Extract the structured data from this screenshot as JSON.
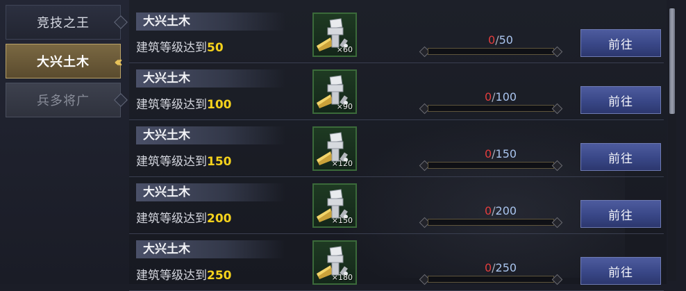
{
  "sidebar": {
    "tabs": [
      {
        "label": "竞技之王",
        "state": "normal"
      },
      {
        "label": "大兴土木",
        "state": "active"
      },
      {
        "label": "兵多将广",
        "state": "disabled"
      }
    ]
  },
  "tasks": [
    {
      "title": "大兴土木",
      "desc_prefix": "建筑等级达到",
      "target": "50",
      "reward_icon": "hammer-icon",
      "reward_count": "×60",
      "current": "0",
      "slash": "/",
      "total": "50",
      "button": "前往"
    },
    {
      "title": "大兴土木",
      "desc_prefix": "建筑等级达到",
      "target": "100",
      "reward_icon": "hammer-icon",
      "reward_count": "×90",
      "current": "0",
      "slash": "/",
      "total": "100",
      "button": "前往"
    },
    {
      "title": "大兴土木",
      "desc_prefix": "建筑等级达到",
      "target": "150",
      "reward_icon": "hammer-icon",
      "reward_count": "×120",
      "current": "0",
      "slash": "/",
      "total": "150",
      "button": "前往"
    },
    {
      "title": "大兴土木",
      "desc_prefix": "建筑等级达到",
      "target": "200",
      "reward_icon": "hammer-icon",
      "reward_count": "×150",
      "current": "0",
      "slash": "/",
      "total": "200",
      "button": "前往"
    },
    {
      "title": "大兴土木",
      "desc_prefix": "建筑等级达到",
      "target": "250",
      "reward_icon": "hammer-icon",
      "reward_count": "×180",
      "current": "0",
      "slash": "/",
      "total": "250",
      "button": "前往"
    }
  ],
  "colors": {
    "accent_gold": "#f5d21c",
    "progress_current": "#e23d3d",
    "progress_total": "#a9c4ee",
    "button_blue": "#394787"
  }
}
